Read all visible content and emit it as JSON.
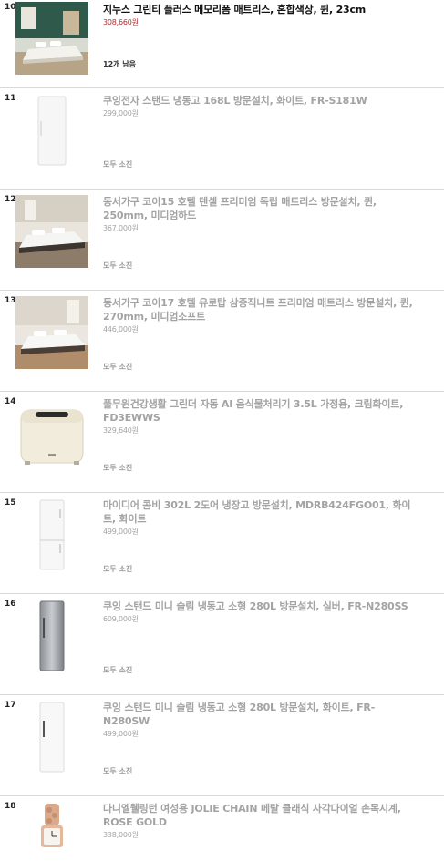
{
  "products": [
    {
      "rank": "10",
      "title": "지누스 그린티 플러스 메모리폼 매트리스, 혼합색상, 퀸, 23cm",
      "price": "308,660원",
      "stock": "12개 남음",
      "image_icon": "mattress-bedroom-photo",
      "active": true
    },
    {
      "rank": "11",
      "title": "쿠잉전자 스탠드 냉동고 168L 방문설치, 화이트, FR-S181W",
      "price": "299,000원",
      "stock": "모두 소진",
      "image_icon": "white-freezer-photo",
      "active": false
    },
    {
      "rank": "12",
      "title": "동서가구 코이15 호텔 텐셀 프리미엄 독립 매트리스 방문설치, 퀸, 250mm, 미디엄하드",
      "price": "367,000원",
      "stock": "모두 소진",
      "image_icon": "bed-mattress-photo",
      "active": false
    },
    {
      "rank": "13",
      "title": "동서가구 코이17 호텔 유로탑 삼중직니트 프리미엄 매트리스 방문설치, 퀸, 270mm, 미디엄소프트",
      "price": "446,000원",
      "stock": "모두 소진",
      "image_icon": "bed-mattress-photo",
      "active": false
    },
    {
      "rank": "14",
      "title": "풀무원건강생활 그린더 자동 AI 음식물처리기 3.5L 가정용, 크림화이트, FD3EWWS",
      "price": "329,640원",
      "stock": "모두 소진",
      "image_icon": "food-waste-processor-photo",
      "active": false
    },
    {
      "rank": "15",
      "title": "마이디어 콤비 302L 2도어 냉장고 방문설치, MDRB424FGO01, 화이트, 화이트",
      "price": "499,000원",
      "stock": "모두 소진",
      "image_icon": "white-fridge-photo",
      "active": false
    },
    {
      "rank": "16",
      "title": "쿠잉 스탠드 미니 슬림 냉동고 소형 280L 방문설치, 실버, FR-N280SS",
      "price": "609,000원",
      "stock": "모두 소진",
      "image_icon": "silver-freezer-photo",
      "active": false
    },
    {
      "rank": "17",
      "title": "쿠잉 스탠드 미니 슬림 냉동고 소형 280L 방문설치, 화이트, FR-N280SW",
      "price": "499,000원",
      "stock": "모두 소진",
      "image_icon": "white-freezer-photo",
      "active": false
    },
    {
      "rank": "18",
      "title": "다니엘웰링턴 여성용 JOLIE CHAIN 메탈 클래식 사각다이얼 손목시계, ROSE GOLD",
      "price": "338,000원",
      "stock": "",
      "image_icon": "rose-gold-watch-photo",
      "active": false
    }
  ]
}
